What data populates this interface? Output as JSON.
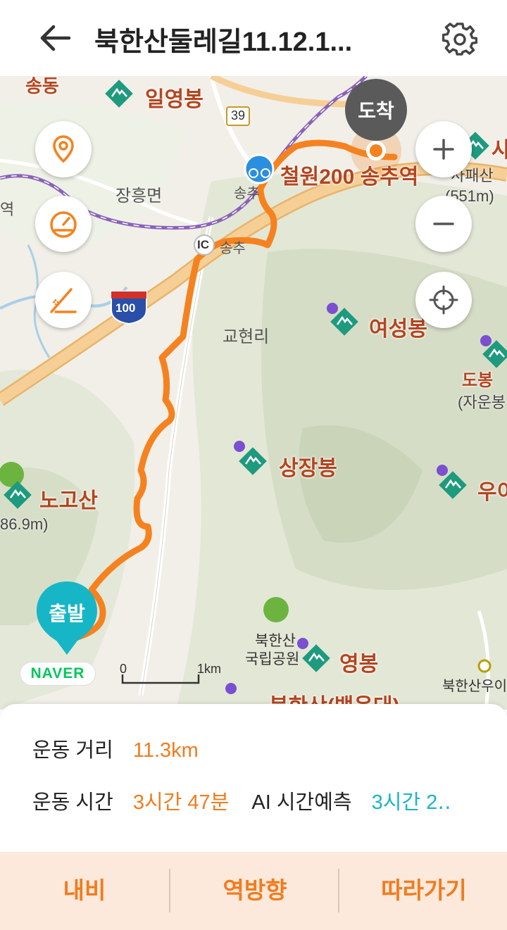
{
  "header": {
    "title": "북한산둘레길11.12.1...",
    "back_icon": "arrow-left-icon",
    "settings_icon": "gear-icon"
  },
  "map": {
    "labels": {
      "jangheung": "장흥면",
      "gyohyeon": "교현리",
      "songchu_small": "송추",
      "ic": "IC",
      "ic_name": "송추",
      "route39": "39",
      "route100": "100",
      "station_left": "역",
      "bukhansan_park": "북한산",
      "bukhansan_park2": "국립공원",
      "station_right": "북한산우이"
    },
    "peaks": {
      "ilyeong": "일영봉",
      "yeoseong": "여성봉",
      "sangjang": "상장봉",
      "nogo": "노고산",
      "nogo_height": "86.9m)",
      "yeong": "영봉",
      "baegundae": "북한산(백운대)",
      "sapae_height": "사패산\n(551m)",
      "sapae_height_line": "(551m)",
      "sapae_partial": "사패산",
      "dobong": "도봉",
      "dobong_sub": "(자운봉",
      "ui": "우이",
      "top_partial": "송동",
      "right_top_partial": "사"
    },
    "poi_songchu": "철원200 송추역",
    "arrive_label": "도착",
    "start_label": "출발",
    "naver_label": "NAVER",
    "scale_zero": "0",
    "scale_km": "1km",
    "colors": {
      "route": "#f5821f",
      "peak": "#1e9a7e",
      "highway": "#f3c585",
      "rail": "#8a62b7"
    },
    "controls": [
      {
        "name": "location-pin-icon"
      },
      {
        "name": "speedometer-icon"
      },
      {
        "name": "elevation-icon"
      },
      {
        "name": "zoom-in-icon"
      },
      {
        "name": "zoom-out-icon"
      },
      {
        "name": "crosshair-icon"
      }
    ]
  },
  "info": {
    "distance_label": "운동 거리",
    "distance_value": "11.3km",
    "time_label": "운동 시간",
    "time_value": "3시간 47분",
    "ai_label": "AI 시간예측",
    "ai_value": "3시간 2‥"
  },
  "bottom": {
    "navi": "내비",
    "reverse": "역방향",
    "follow": "따라가기"
  }
}
